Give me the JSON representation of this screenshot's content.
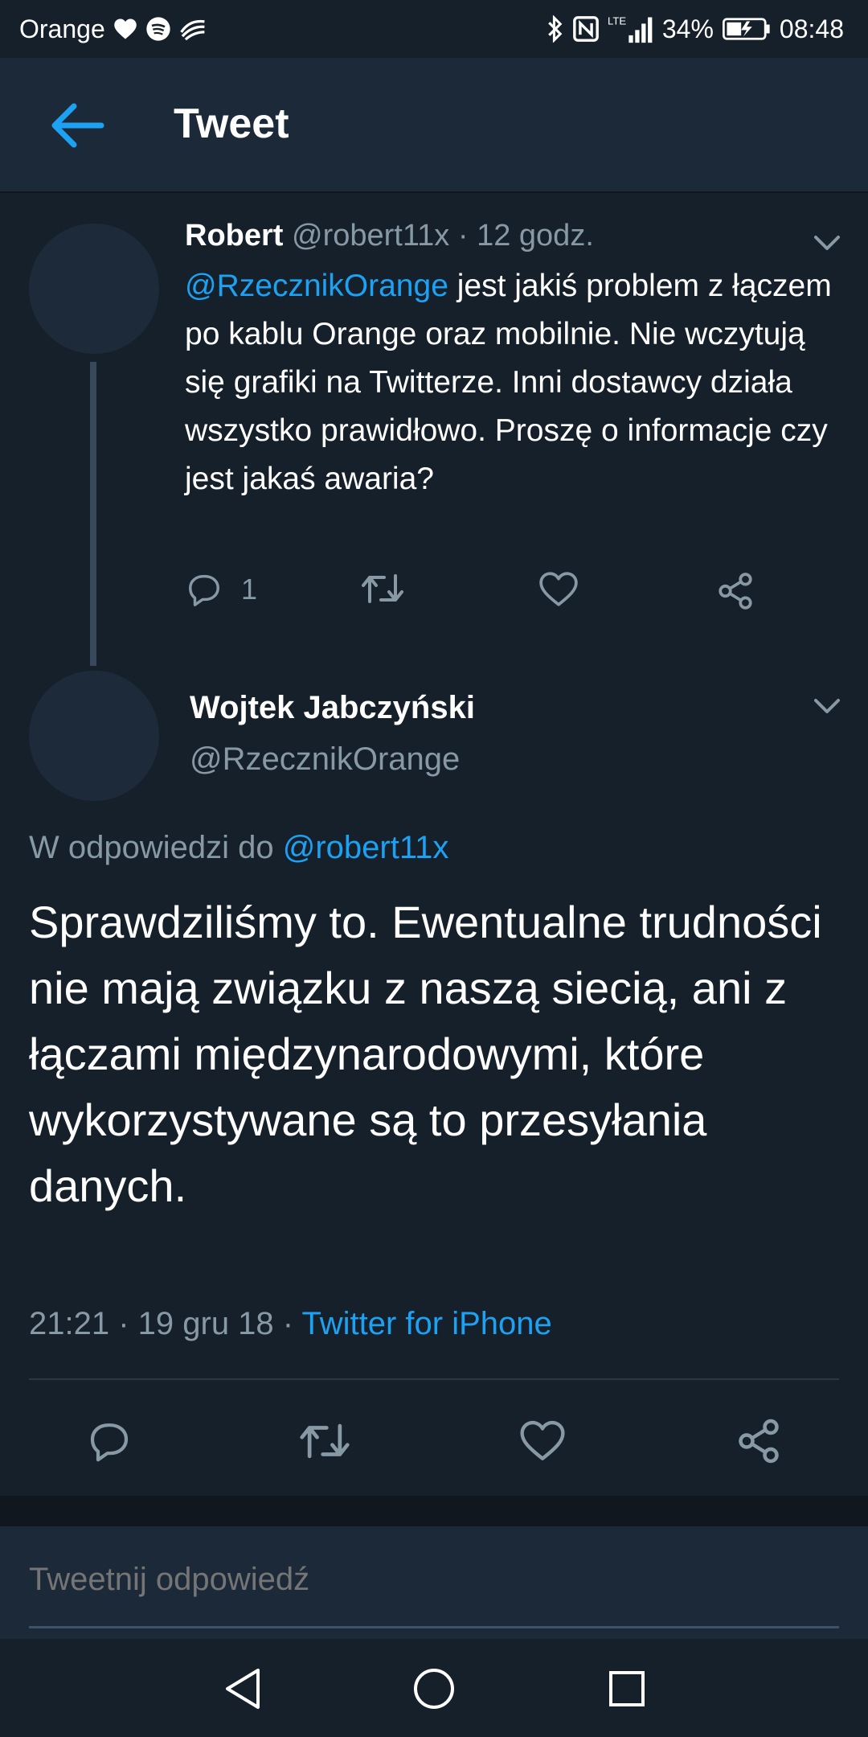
{
  "status_bar": {
    "carrier": "Orange",
    "battery": "34%",
    "time": "08:48",
    "network": "LTE",
    "icons": [
      "heart-icon",
      "spotify-icon",
      "sync-icon",
      "bluetooth-icon",
      "nfc-icon",
      "signal-icon",
      "battery-icon"
    ]
  },
  "header": {
    "title": "Tweet",
    "back_icon": "arrow-left-icon"
  },
  "parent_tweet": {
    "name": "Robert",
    "handle": "@robert11x",
    "time": "· 12 godz.",
    "mention": "@RzecznikOrange",
    "text": " jest jakiś problem z łączem po kablu Orange oraz mobilnie. Nie wczytują się grafiki na Twitterze. Inni dostawcy działa wszystko prawidłowo. Proszę o informacje czy jest jakaś awaria?",
    "reply_count": "1"
  },
  "main_tweet": {
    "name": "Wojtek Jabczyński",
    "handle": "@RzecznikOrange",
    "replying_prefix": "W odpowiedzi do",
    "replying_to": "@robert11x",
    "text": "Sprawdziliśmy to. Ewentualne trudności nie mają związku z naszą  siecią, ani z łączami międzynarodowymi, które wykorzystywane są to przesyłania danych.",
    "meta": "21:21 · 19 gru 18 · ",
    "source": "Twitter for iPhone"
  },
  "reply_box": {
    "placeholder": "Tweetnij odpowiedź"
  },
  "colors": {
    "background": "#15202b",
    "bar": "#1c2938",
    "accent": "#1da1f2",
    "secondary_text": "#8899a6"
  }
}
